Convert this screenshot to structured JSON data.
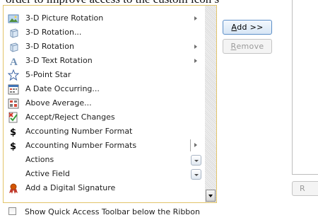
{
  "instruction_text": "order to improve access to the custom icon s",
  "commands": [
    {
      "label": "3-D Picture Rotation",
      "icon": "picture-rotation-icon",
      "indicator": "submenu"
    },
    {
      "label": "3-D Rotation...",
      "icon": "rotation-icon",
      "indicator": ""
    },
    {
      "label": "3-D Rotation",
      "icon": "rotation-icon",
      "indicator": "submenu"
    },
    {
      "label": "3-D Text Rotation",
      "icon": "text-rotation-icon",
      "indicator": "submenu"
    },
    {
      "label": "5-Point Star",
      "icon": "star-icon",
      "indicator": ""
    },
    {
      "label": "A Date Occurring...",
      "icon": "date-occurring-icon",
      "indicator": ""
    },
    {
      "label": "Above Average...",
      "icon": "above-average-icon",
      "indicator": ""
    },
    {
      "label": "Accept/Reject Changes",
      "icon": "accept-reject-icon",
      "indicator": ""
    },
    {
      "label": "Accounting Number Format",
      "icon": "dollar-icon",
      "indicator": ""
    },
    {
      "label": "Accounting Number Formats",
      "icon": "dollar-icon",
      "indicator": "split"
    },
    {
      "label": "Actions",
      "icon": "",
      "indicator": "dropdown"
    },
    {
      "label": "Active Field",
      "icon": "",
      "indicator": "dropdown"
    },
    {
      "label": "Add a Digital Signature",
      "icon": "digital-signature-icon",
      "indicator": ""
    }
  ],
  "buttons": {
    "add": "Add >>",
    "remove": "Remove",
    "right_partial": "R"
  },
  "checkbox": {
    "label": "Show Quick Access Toolbar below the Ribbon",
    "checked": false
  },
  "colors": {
    "list_border": "#e2c46a",
    "add_border": "#5c8fc8",
    "disabled_text": "#9a9a9a",
    "dollar": "#000000"
  }
}
